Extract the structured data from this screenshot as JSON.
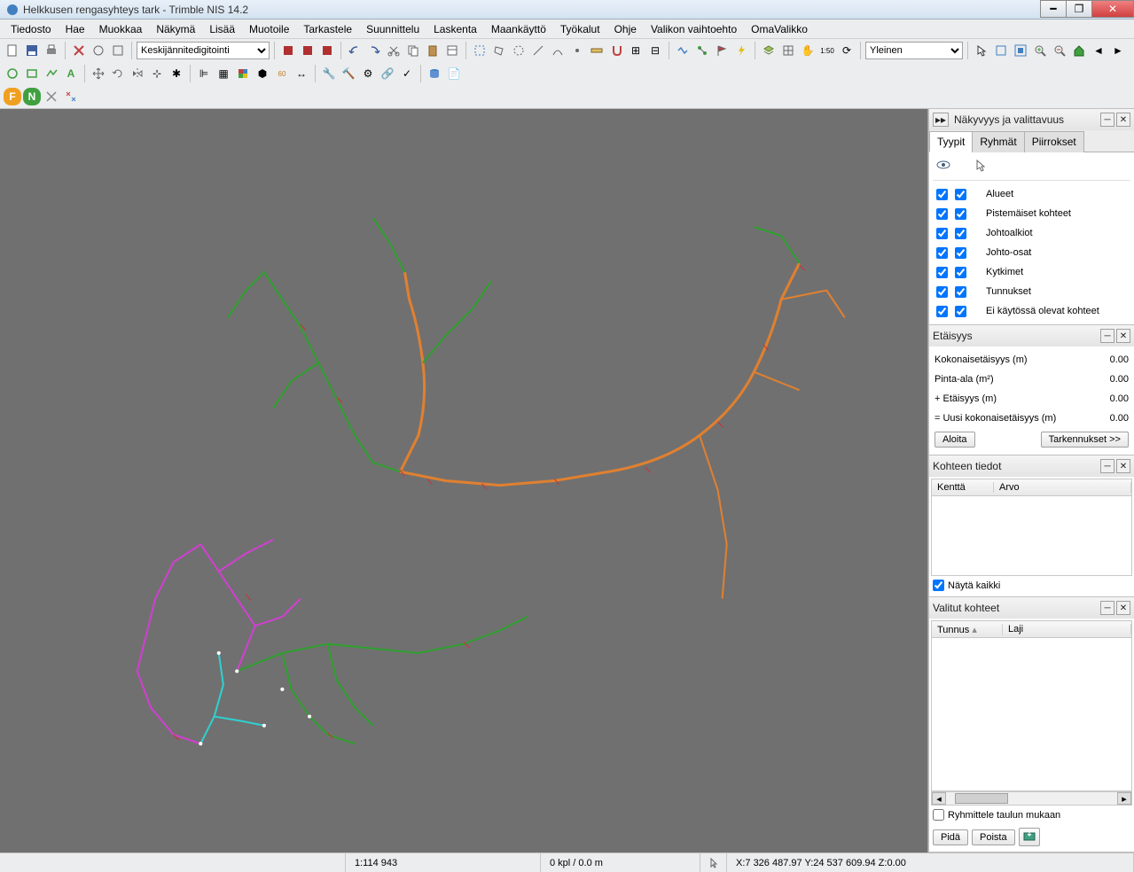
{
  "window": {
    "title": "Helkkusen rengasyhteys tark - Trimble NIS 14.2"
  },
  "menu": [
    "Tiedosto",
    "Hae",
    "Muokkaa",
    "Näkymä",
    "Lisää",
    "Muotoile",
    "Tarkastele",
    "Suunnittelu",
    "Laskenta",
    "Maankäyttö",
    "Työkalut",
    "Ohje",
    "Valikon vaihtoehto",
    "OmaValikko"
  ],
  "toolbars": {
    "mode_select": "Keskijännitedigitointi",
    "view_select": "Yleinen"
  },
  "panels": {
    "visibility": {
      "title": "Näkyvyys ja valittavuus",
      "tabs": [
        "Tyypit",
        "Ryhmät",
        "Piirrokset"
      ],
      "active_tab": 0,
      "layers": [
        {
          "label": "Alueet",
          "vis": true,
          "sel": true
        },
        {
          "label": "Pistemäiset kohteet",
          "vis": true,
          "sel": true
        },
        {
          "label": "Johtoalkiot",
          "vis": true,
          "sel": true
        },
        {
          "label": "Johto-osat",
          "vis": true,
          "sel": true
        },
        {
          "label": "Kytkimet",
          "vis": true,
          "sel": true
        },
        {
          "label": "Tunnukset",
          "vis": true,
          "sel": true
        },
        {
          "label": "Ei käytössä olevat kohteet",
          "vis": true,
          "sel": true
        }
      ]
    },
    "distance": {
      "title": "Etäisyys",
      "rows": [
        {
          "label": "Kokonaisetäisyys (m)",
          "value": "0.00"
        },
        {
          "label": "Pinta-ala (m²)",
          "value": "0.00"
        },
        {
          "label": "+ Etäisyys (m)",
          "value": "0.00"
        },
        {
          "label": "= Uusi kokonaisetäisyys (m)",
          "value": "0.00"
        }
      ],
      "start_btn": "Aloita",
      "details_btn": "Tarkennukset >>"
    },
    "object_info": {
      "title": "Kohteen tiedot",
      "cols": [
        "Kenttä",
        "Arvo"
      ],
      "show_all": "Näytä kaikki",
      "show_all_checked": true
    },
    "selected": {
      "title": "Valitut kohteet",
      "cols": [
        "Tunnus",
        "Laji"
      ],
      "group_by": "Ryhmittele taulun mukaan",
      "group_by_checked": false,
      "keep_btn": "Pidä",
      "remove_btn": "Poista"
    }
  },
  "statusbar": {
    "scale": "1:114 943",
    "count": "0 kpl / 0.0 m",
    "coords": "X:7 326 487.97  Y:24 537 609.94  Z:0.00"
  }
}
